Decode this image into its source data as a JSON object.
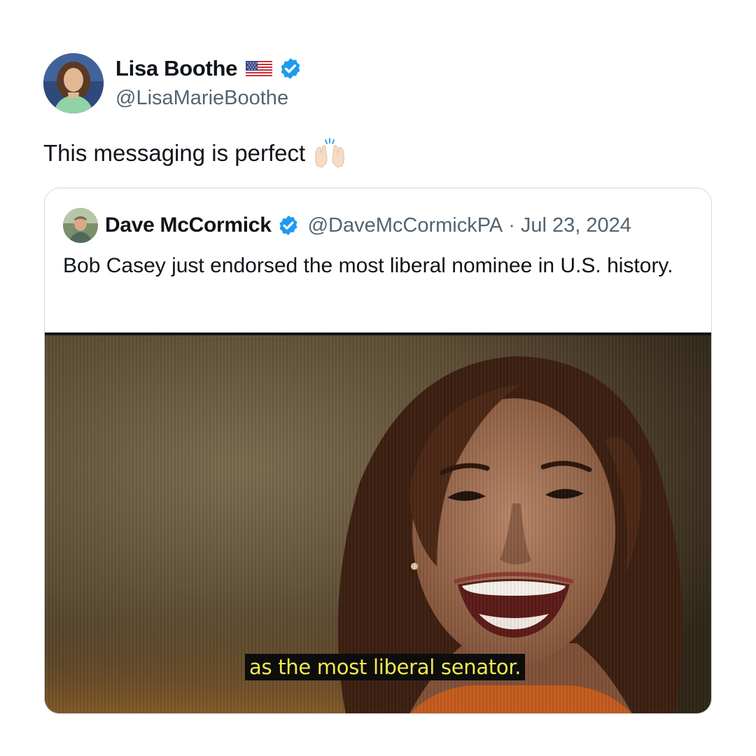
{
  "tweet": {
    "author": {
      "name": "Lisa Boothe",
      "handle": "@LisaMarieBoothe",
      "flag_icon": "us-flag-icon",
      "verified_icon": "verified-badge-icon"
    },
    "text": "This messaging is perfect",
    "emoji_icon": "raising-hands-icon"
  },
  "quoted_tweet": {
    "author": {
      "name": "Dave McCormick",
      "handle": "@DaveMcCormickPA",
      "verified_icon": "verified-badge-icon"
    },
    "separator": "·",
    "date": "Jul 23, 2024",
    "text": "Bob Casey just endorsed the most liberal nominee in U.S. history.",
    "media": {
      "subtitle": "as the most liberal senator."
    }
  },
  "colors": {
    "verified": "#1d9bf0",
    "secondary_text": "#536471",
    "border": "#cfd9de",
    "subtitle_text": "#f2e94e"
  }
}
